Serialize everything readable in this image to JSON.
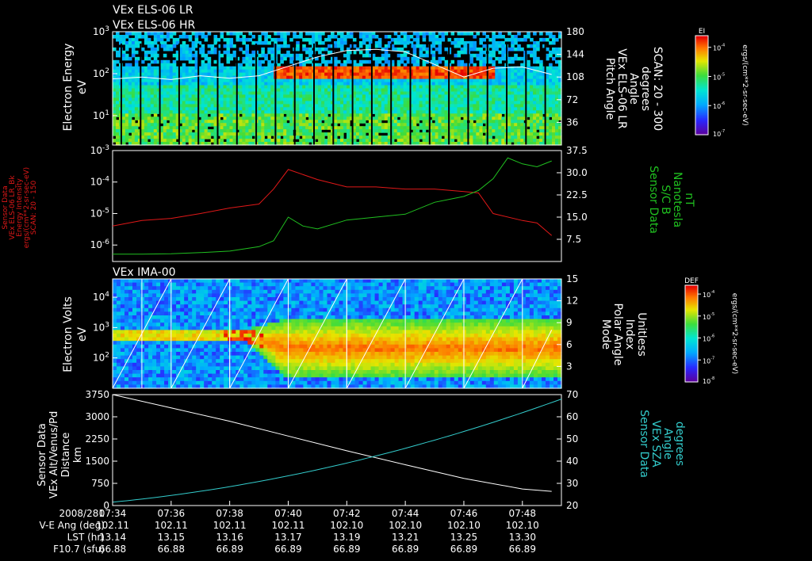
{
  "titles": {
    "lr": "VEx ELS-06 LR",
    "hr": "VEx ELS-06 HR",
    "ima": "VEx IMA-00"
  },
  "colors": {
    "background": "#000000",
    "axis": "#ffffff",
    "red_series": "#e01818",
    "green_series": "#20c020",
    "cyan_series": "#33cccc",
    "white_series": "#ffffff"
  },
  "chart_data": [
    {
      "id": "panel1",
      "type": "heatmap",
      "ylabel": [
        "Electron Energy",
        "eV"
      ],
      "yscale": "log",
      "ylim": [
        2,
        1000
      ],
      "y_ticks": [
        {
          "value": 10,
          "base": "10",
          "exp": "1"
        },
        {
          "value": 100,
          "base": "10",
          "exp": "2"
        },
        {
          "value": 1000,
          "base": "10",
          "exp": "3"
        }
      ],
      "right_ylabel": [
        "Pitch Angle",
        "VEx ELS-06 LR",
        "Angle",
        "degrees",
        "SCAN: 20 - 300"
      ],
      "right_ylim": [
        0,
        180
      ],
      "right_ticks": [
        "36",
        "72",
        "108",
        "144",
        "180"
      ],
      "colorbar": {
        "label": "EI",
        "units": "ergs/(cm**2-sr-sec-eV)",
        "ticks": [
          {
            "base": "10",
            "exp": "-4"
          },
          {
            "base": "10",
            "exp": "-5"
          },
          {
            "base": "10",
            "exp": "-6"
          }
        ],
        "min_label": {
          "base": "10",
          "exp": "-7"
        }
      },
      "series": [
        {
          "kind": "pitch-angle-line",
          "color": "white",
          "x": [
            "07:34:00",
            "07:35:00",
            "07:36:00",
            "07:37:00",
            "07:38:00",
            "07:39:00",
            "07:40:00",
            "07:41:00",
            "07:42:00",
            "07:43:00",
            "07:44:00",
            "07:45:00",
            "07:46:00",
            "07:47:00",
            "07:48:00",
            "07:49:00"
          ],
          "values": [
            105,
            108,
            104,
            110,
            106,
            110,
            125,
            140,
            150,
            152,
            148,
            128,
            108,
            122,
            124,
            112
          ]
        }
      ]
    },
    {
      "id": "panel2",
      "type": "line",
      "ylabel": [
        "Sensor Data",
        "VEx ELS-06 LR_Bk",
        "Energy Intensity",
        "ergs/(cm**2-sr-sec-eV)",
        "SCAN: 20 - 150"
      ],
      "ylabel_color": "red",
      "yscale": "log",
      "ylim": [
        3e-07,
        0.001
      ],
      "y_ticks": [
        {
          "value": 1e-06,
          "base": "10",
          "exp": "-6"
        },
        {
          "value": 1e-05,
          "base": "10",
          "exp": "-5"
        },
        {
          "value": 0.0001,
          "base": "10",
          "exp": "-4"
        },
        {
          "value": 0.001,
          "base": "10",
          "exp": "-3"
        }
      ],
      "right_ylabel": [
        "Sensor Data",
        "S/C B",
        "Nanotesla",
        "nT"
      ],
      "right_ylabel_color": "green",
      "right_ylim": [
        0,
        37.5
      ],
      "right_ticks": [
        "7.5",
        "15.0",
        "22.5",
        "30.0",
        "37.5"
      ],
      "series": [
        {
          "name": "Energy Intensity",
          "color": "red",
          "x": [
            "07:34:00",
            "07:35:00",
            "07:36:00",
            "07:37:00",
            "07:38:00",
            "07:39:00",
            "07:39:30",
            "07:40:00",
            "07:41:00",
            "07:42:00",
            "07:43:00",
            "07:44:00",
            "07:45:00",
            "07:46:00",
            "07:46:30",
            "07:47:00",
            "07:48:00",
            "07:48:30",
            "07:49:00"
          ],
          "values": [
            4e-06,
            6e-06,
            7e-06,
            1e-05,
            1.5e-05,
            2e-05,
            6e-05,
            0.00025,
            0.00012,
            7e-05,
            7e-05,
            6e-05,
            6e-05,
            5e-05,
            4.5e-05,
            1e-05,
            6e-06,
            5e-06,
            2e-06
          ]
        },
        {
          "name": "S/C B",
          "color": "green",
          "x": [
            "07:34:00",
            "07:35:00",
            "07:36:00",
            "07:37:00",
            "07:38:00",
            "07:39:00",
            "07:39:30",
            "07:40:00",
            "07:40:30",
            "07:41:00",
            "07:42:00",
            "07:43:00",
            "07:44:00",
            "07:45:00",
            "07:46:00",
            "07:46:30",
            "07:47:00",
            "07:47:30",
            "07:48:00",
            "07:48:30",
            "07:49:00"
          ],
          "values": [
            2.5,
            2.5,
            2.6,
            3.0,
            3.5,
            5,
            7,
            15,
            12,
            11,
            14,
            15,
            16,
            20,
            22,
            24,
            28,
            35,
            33,
            32,
            34
          ]
        }
      ]
    },
    {
      "id": "panel3",
      "type": "heatmap",
      "title": "VEx IMA-00",
      "ylabel": [
        "Electron Volts",
        "eV"
      ],
      "yscale": "log",
      "ylim": [
        10,
        40000
      ],
      "y_ticks": [
        {
          "value": 100,
          "base": "10",
          "exp": "2"
        },
        {
          "value": 1000,
          "base": "10",
          "exp": "3"
        },
        {
          "value": 10000,
          "base": "10",
          "exp": "4"
        }
      ],
      "right_ylabel": [
        "Mode",
        "Polar Angle",
        "Index",
        "Unitless"
      ],
      "right_ylim": [
        0,
        15
      ],
      "right_ticks": [
        "3",
        "6",
        "9",
        "12",
        "15"
      ],
      "colorbar": {
        "label": "DEF",
        "units": "ergs/(cm**2-sr-sec-eV)",
        "ticks": [
          {
            "base": "10",
            "exp": "-4"
          },
          {
            "base": "10",
            "exp": "-5"
          },
          {
            "base": "10",
            "exp": "-6"
          },
          {
            "base": "10",
            "exp": "-7"
          }
        ],
        "min_label": {
          "base": "10",
          "exp": "-8"
        }
      },
      "series": [
        {
          "kind": "polar-angle-sawtooth",
          "color": "white",
          "x": [
            "07:34:00",
            "07:36:00",
            "07:36:00",
            "07:38:00",
            "07:38:00",
            "07:40:00",
            "07:40:00",
            "07:42:00",
            "07:42:00",
            "07:44:00",
            "07:44:00",
            "07:46:00",
            "07:46:00",
            "07:48:00",
            "07:48:00",
            "07:49:00"
          ],
          "values": [
            0,
            15,
            0,
            15,
            0,
            15,
            0,
            15,
            0,
            15,
            0,
            15,
            0,
            15,
            0,
            8
          ]
        }
      ]
    },
    {
      "id": "panel4",
      "type": "line",
      "ylabel": [
        "Sensor Data",
        "VEx Alt/Venus/Pd",
        "Distance",
        "km"
      ],
      "ylim": [
        0,
        3750
      ],
      "y_ticks": [
        "0",
        "750",
        "1500",
        "2250",
        "3000",
        "3750"
      ],
      "right_ylabel": [
        "Sensor Data",
        "VEx SZA",
        "Angle",
        "degrees"
      ],
      "right_ylabel_color": "cyan",
      "right_ylim": [
        20,
        70
      ],
      "right_ticks": [
        "20",
        "30",
        "40",
        "50",
        "60",
        "70"
      ],
      "series": [
        {
          "name": "VEx Alt/Venus/Pd",
          "color": "white",
          "x": [
            "07:34:00",
            "07:36:00",
            "07:38:00",
            "07:40:00",
            "07:42:00",
            "07:44:00",
            "07:46:00",
            "07:48:00",
            "07:49:00"
          ],
          "values": [
            3750,
            3300,
            2850,
            2350,
            1850,
            1380,
            920,
            560,
            480
          ]
        },
        {
          "name": "VEx SZA",
          "color": "cyan",
          "x": [
            "07:34:00",
            "07:36:00",
            "07:38:00",
            "07:40:00",
            "07:42:00",
            "07:44:00",
            "07:46:00",
            "07:48:00",
            "07:49:00"
          ],
          "values": [
            21.5,
            24.5,
            28,
            33,
            39,
            46,
            54,
            63,
            68
          ]
        }
      ]
    }
  ],
  "xaxis": {
    "labels": [
      "2008/281",
      "V-E Ang (deg)",
      "LST (hr)",
      "F10.7 (sfu)"
    ],
    "columns": [
      {
        "time": "07:34",
        "ve": "102.11",
        "lst": "13.14",
        "f107": "66.88"
      },
      {
        "time": "07:36",
        "ve": "102.11",
        "lst": "13.15",
        "f107": "66.88"
      },
      {
        "time": "07:38",
        "ve": "102.11",
        "lst": "13.16",
        "f107": "66.89"
      },
      {
        "time": "07:40",
        "ve": "102.11",
        "lst": "13.17",
        "f107": "66.89"
      },
      {
        "time": "07:42",
        "ve": "102.10",
        "lst": "13.19",
        "f107": "66.89"
      },
      {
        "time": "07:44",
        "ve": "102.10",
        "lst": "13.21",
        "f107": "66.89"
      },
      {
        "time": "07:46",
        "ve": "102.10",
        "lst": "13.25",
        "f107": "66.89"
      },
      {
        "time": "07:48",
        "ve": "102.10",
        "lst": "13.30",
        "f107": "66.89"
      }
    ]
  }
}
